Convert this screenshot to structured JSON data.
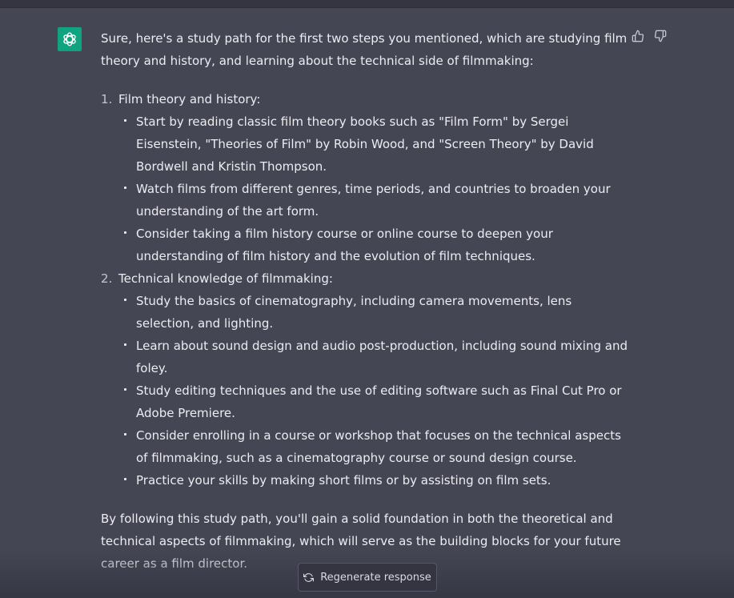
{
  "assistant": {
    "avatar_icon": "openai-logo-icon",
    "avatar_color": "#10a37f"
  },
  "feedback": {
    "thumbs_up_icon": "thumbs-up-icon",
    "thumbs_down_icon": "thumbs-down-icon"
  },
  "message": {
    "intro": "Sure, here's a study path for the first two steps you mentioned, which are studying film theory and history, and learning about the technical side of filmmaking:",
    "steps": [
      {
        "number": "1.",
        "title": "Film theory and history:",
        "items": [
          "Start by reading classic film theory books such as \"Film Form\" by Sergei Eisenstein, \"Theories of Film\" by Robin Wood, and \"Screen Theory\" by David Bordwell and Kristin Thompson.",
          "Watch films from different genres, time periods, and countries to broaden your understanding of the art form.",
          "Consider taking a film history course or online course to deepen your understanding of film history and the evolution of film techniques."
        ]
      },
      {
        "number": "2.",
        "title": "Technical knowledge of filmmaking:",
        "items": [
          "Study the basics of cinematography, including camera movements, lens selection, and lighting.",
          "Learn about sound design and audio post-production, including sound mixing and foley.",
          "Study editing techniques and the use of editing software such as Final Cut Pro or Adobe Premiere.",
          "Consider enrolling in a course or workshop that focuses on the technical aspects of filmmaking, such as a cinematography course or sound design course.",
          "Practice your skills by making short films or by assisting on film sets."
        ]
      }
    ],
    "outro": "By following this study path, you'll gain a solid foundation in both the theoretical and technical aspects of filmmaking, which will serve as the building blocks for your future career as a film director."
  },
  "regenerate": {
    "label": "Regenerate response",
    "icon": "refresh-icon"
  }
}
